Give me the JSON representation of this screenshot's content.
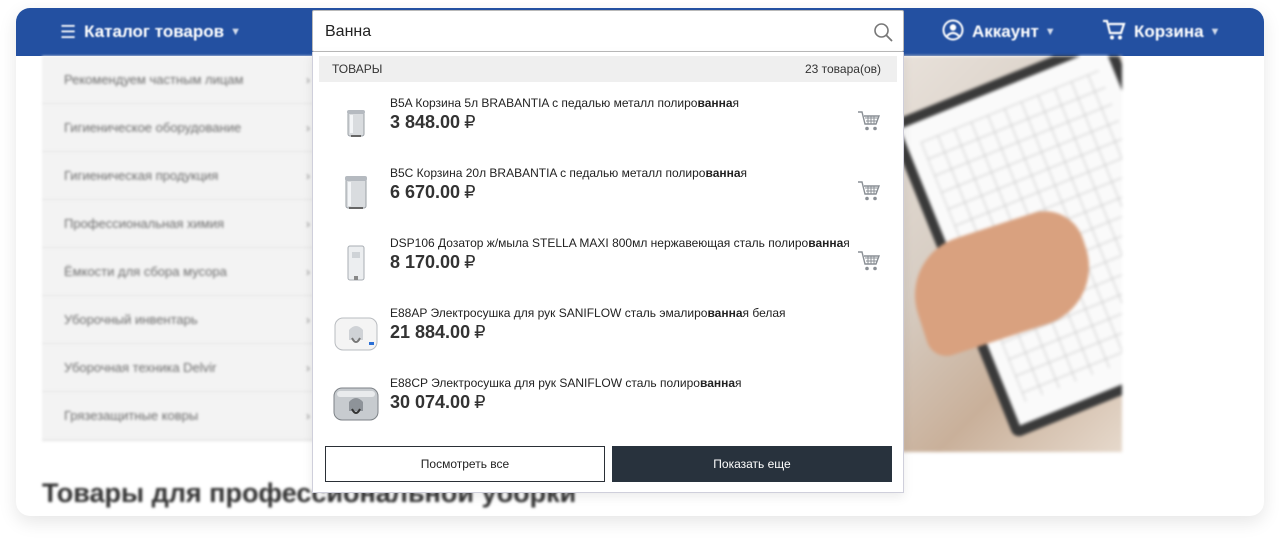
{
  "header": {
    "catalog_label": "Каталог товаров",
    "account_label": "Аккаунт",
    "cart_label": "Корзина",
    "brand_color": "#2350a1"
  },
  "sidebar": {
    "items": [
      {
        "label": "Рекомендуем частным лицам"
      },
      {
        "label": "Гигиеническое оборудование"
      },
      {
        "label": "Гигиеническая продукция"
      },
      {
        "label": "Профессиональная химия"
      },
      {
        "label": "Ёмкости для сбора мусора"
      },
      {
        "label": "Уборочный инвентарь"
      },
      {
        "label": "Уборочная техника Delvir"
      },
      {
        "label": "Грязезащитные ковры"
      }
    ]
  },
  "page": {
    "heading": "Товары для профессиональной уборки"
  },
  "search": {
    "value": "Ванна",
    "section_title": "ТОВАРЫ",
    "count_label": "23 товара(ов)",
    "view_all_label": "Посмотреть все",
    "show_more_label": "Показать еще",
    "products": [
      {
        "name_before": "B5A Корзина 5л BRABANTIA с педалью металл полиро",
        "name_match": "ванна",
        "name_after": "я",
        "price": "3 848.00",
        "currency": "₽",
        "thumb": "small-pedal-bin"
      },
      {
        "name_before": "B5C Корзина 20л BRABANTIA с педалью металл полиро",
        "name_match": "ванна",
        "name_after": "я",
        "price": "6 670.00",
        "currency": "₽",
        "thumb": "large-pedal-bin"
      },
      {
        "name_before": "DSP106 Дозатор ж/мыла STELLA MAXI 800мл нержавеющая сталь полиро",
        "name_match": "ванна",
        "name_after": "я",
        "price": "8 170.00",
        "currency": "₽",
        "thumb": "soap-dispenser"
      },
      {
        "name_before": "E88AP Электросушка для рук SANIFLOW сталь эмалиро",
        "name_match": "ванна",
        "name_after": "я белая",
        "price": "21 884.00",
        "currency": "₽",
        "thumb": "white-hand-dryer"
      },
      {
        "name_before": "E88CP Электросушка для рук SANIFLOW сталь полиро",
        "name_match": "ванна",
        "name_after": "я",
        "price": "30 074.00",
        "currency": "₽",
        "thumb": "steel-hand-dryer"
      }
    ]
  }
}
